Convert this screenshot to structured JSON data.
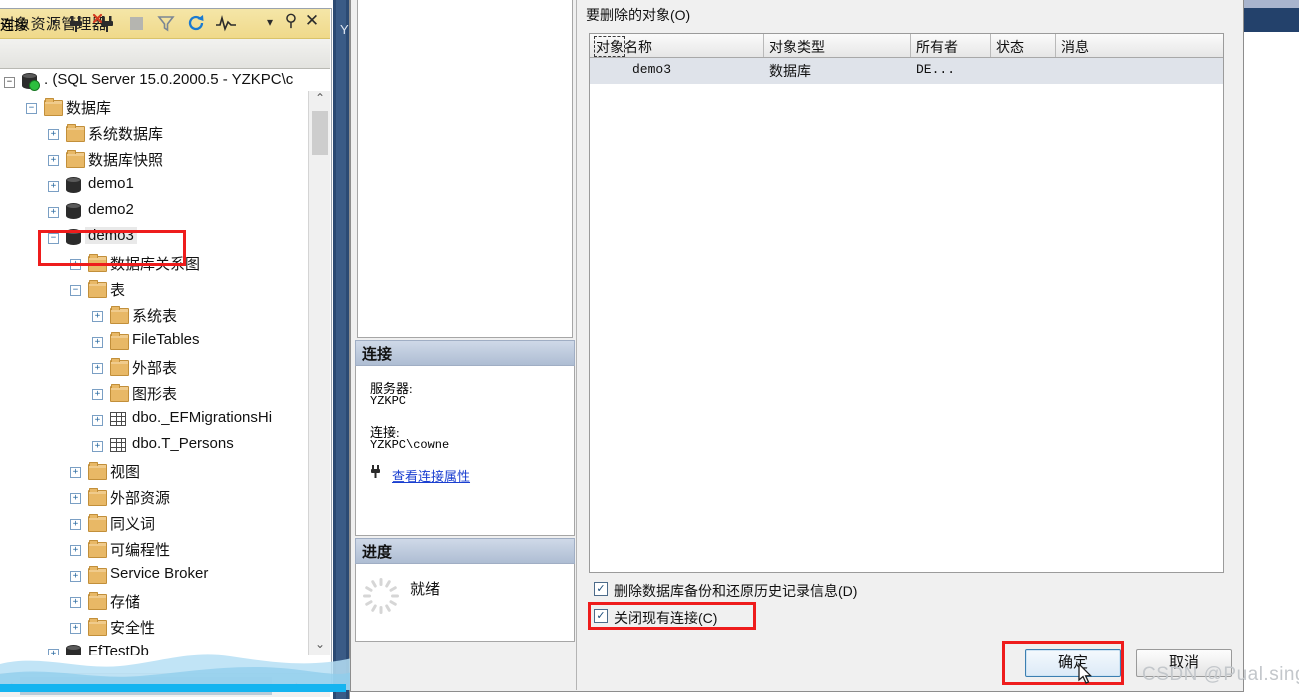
{
  "object_explorer": {
    "title": "对象资源管理器",
    "title_icons": [
      "chevron-down-icon",
      "pin-icon",
      "close-icon"
    ],
    "toolbar": {
      "connect_label": "连接",
      "connect_caret": "▾",
      "buttons": [
        {
          "name": "connect-plug-icon",
          "glyph": "⚊"
        },
        {
          "name": "disconnect-plug-icon",
          "glyph": "⚊"
        },
        {
          "name": "stop-icon",
          "glyph": "■"
        },
        {
          "name": "filter-icon",
          "glyph": "▽"
        },
        {
          "name": "refresh-icon",
          "glyph": "↻"
        },
        {
          "name": "activity-monitor-icon",
          "glyph": "∿"
        }
      ]
    },
    "tree": [
      {
        "label": ". (SQL Server 15.0.2000.5 - YZKPC\\c",
        "indent": 0,
        "expander": "-",
        "icon": "server-db-icon"
      },
      {
        "label": "数据库",
        "indent": 1,
        "expander": "-",
        "icon": "folder-icon"
      },
      {
        "label": "系统数据库",
        "indent": 2,
        "expander": "+",
        "icon": "folder-icon"
      },
      {
        "label": "数据库快照",
        "indent": 2,
        "expander": "+",
        "icon": "folder-icon"
      },
      {
        "label": "demo1",
        "indent": 2,
        "expander": "+",
        "icon": "database-icon"
      },
      {
        "label": "demo2",
        "indent": 2,
        "expander": "+",
        "icon": "database-icon"
      },
      {
        "label": "demo3",
        "indent": 2,
        "expander": "-",
        "icon": "database-icon",
        "selected": true
      },
      {
        "label": "数据库关系图",
        "indent": 3,
        "expander": "+",
        "icon": "folder-icon"
      },
      {
        "label": "表",
        "indent": 3,
        "expander": "-",
        "icon": "folder-icon"
      },
      {
        "label": "系统表",
        "indent": 4,
        "expander": "+",
        "icon": "folder-icon"
      },
      {
        "label": "FileTables",
        "indent": 4,
        "expander": "+",
        "icon": "folder-icon"
      },
      {
        "label": "外部表",
        "indent": 4,
        "expander": "+",
        "icon": "folder-icon"
      },
      {
        "label": "图形表",
        "indent": 4,
        "expander": "+",
        "icon": "folder-icon"
      },
      {
        "label": "dbo._EFMigrationsHi",
        "indent": 4,
        "expander": "+",
        "icon": "table-icon"
      },
      {
        "label": "dbo.T_Persons",
        "indent": 4,
        "expander": "+",
        "icon": "table-icon"
      },
      {
        "label": "视图",
        "indent": 3,
        "expander": "+",
        "icon": "folder-icon"
      },
      {
        "label": "外部资源",
        "indent": 3,
        "expander": "+",
        "icon": "folder-icon"
      },
      {
        "label": "同义词",
        "indent": 3,
        "expander": "+",
        "icon": "folder-icon"
      },
      {
        "label": "可编程性",
        "indent": 3,
        "expander": "+",
        "icon": "folder-icon"
      },
      {
        "label": "Service Broker",
        "indent": 3,
        "expander": "+",
        "icon": "folder-icon"
      },
      {
        "label": "存储",
        "indent": 3,
        "expander": "+",
        "icon": "folder-icon"
      },
      {
        "label": "安全性",
        "indent": 3,
        "expander": "+",
        "icon": "folder-icon"
      },
      {
        "label": "EfTestDb",
        "indent": 2,
        "expander": "+",
        "icon": "database-icon"
      }
    ],
    "scroll_up": "⌃",
    "scroll_down": "⌄",
    "scroll_left": "‹",
    "scroll_right": "›"
  },
  "behind_tab_label": "Y",
  "dialog": {
    "objects_caption": "要删除的对象(O)",
    "grid": {
      "columns": [
        "对象名称",
        "对象类型",
        "所有者",
        "状态",
        "消息"
      ],
      "rows": [
        {
          "name": "demo3",
          "type": "数据库",
          "owner": "DE...",
          "status": "",
          "message": ""
        }
      ]
    },
    "checkboxes": [
      {
        "label": "删除数据库备份和还原历史记录信息(D)",
        "checked": true,
        "mark": "✓"
      },
      {
        "label": "关闭现有连接(C)",
        "checked": true,
        "mark": "✓",
        "highlighted": true
      }
    ],
    "buttons": {
      "ok": "确定",
      "cancel": "取消"
    },
    "connection": {
      "header": "连接",
      "server_label": "服务器:",
      "server_value": "YZKPC",
      "connection_label": "连接:",
      "connection_value": "YZKPC\\cowne",
      "link": "查看连接属性",
      "link_icon": "plug-icon"
    },
    "progress": {
      "header": "进度",
      "status": "就绪",
      "icon": "spinner-icon"
    }
  },
  "watermark": "CSDN @Pual.singer",
  "colors": {
    "title_bar": "#efd98a",
    "highlight_red": "#ee1c1c",
    "accent_blue": "#2d6ca3",
    "link_blue": "#1a3fd0",
    "selected_row": "#dfe3ea",
    "cyan_bar": "#14b4f0"
  }
}
